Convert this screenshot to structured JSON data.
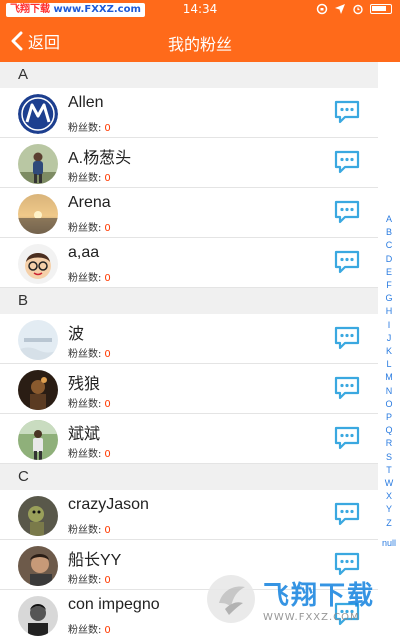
{
  "status_bar": {
    "brand_left": "飞翔下载",
    "brand_url": "www.FXXZ.com",
    "time": "14:34"
  },
  "nav": {
    "back_label": "返回",
    "title": "我的粉丝"
  },
  "fans_label": "粉丝数:",
  "sections": [
    {
      "letter": "A",
      "rows": [
        {
          "name": "Allen",
          "count": "0",
          "avatar": "motorola-logo"
        },
        {
          "name": "A.杨葱头",
          "count": "0",
          "avatar": "person-photo"
        },
        {
          "name": "Arena",
          "count": "0",
          "avatar": "sunset-photo"
        },
        {
          "name": "a,aa",
          "count": "0",
          "avatar": "cartoon-face"
        }
      ]
    },
    {
      "letter": "B",
      "rows": [
        {
          "name": "波",
          "count": "0",
          "avatar": "sky-photo"
        },
        {
          "name": "残狼",
          "count": "0",
          "avatar": "dark-photo"
        },
        {
          "name": "斌斌",
          "count": "0",
          "avatar": "outdoor-photo"
        }
      ]
    },
    {
      "letter": "C",
      "rows": [
        {
          "name": "crazyJason",
          "count": "0",
          "avatar": "toy-photo"
        },
        {
          "name": "船长YY",
          "count": "0",
          "avatar": "portrait-photo"
        },
        {
          "name": "con impegno",
          "count": "0",
          "avatar": "bw-photo"
        }
      ]
    }
  ],
  "index_bar": {
    "letters": [
      "A",
      "B",
      "C",
      "D",
      "E",
      "F",
      "G",
      "H",
      "I",
      "J",
      "K",
      "L",
      "M",
      "N",
      "O",
      "P",
      "Q",
      "R",
      "S",
      "T",
      "W",
      "X",
      "Y",
      "Z"
    ],
    "tail": "null"
  },
  "watermark": {
    "text": "飞翔下载",
    "url": "WWW.FXXZ.COM"
  },
  "colors": {
    "accent": "#ff6a1a",
    "index": "#2a7be0",
    "count": "#ff3a00",
    "message_icon": "#3aa8e0"
  }
}
